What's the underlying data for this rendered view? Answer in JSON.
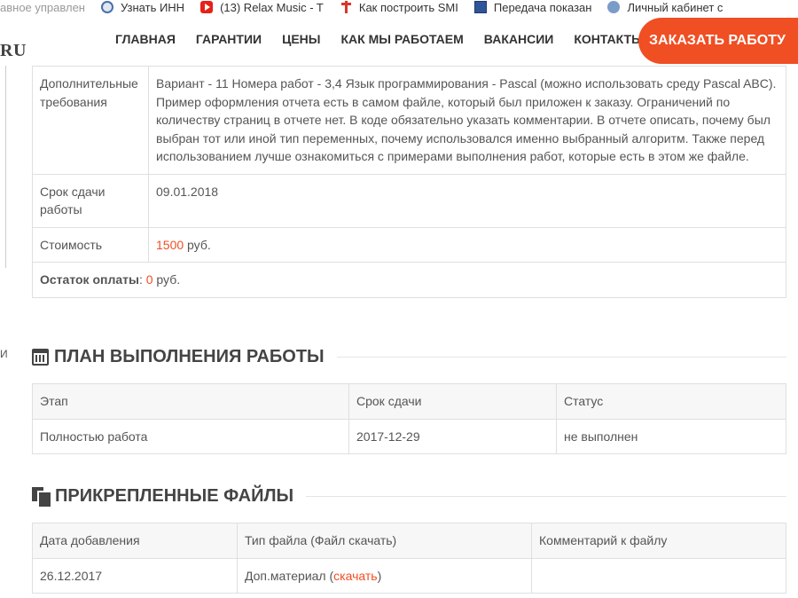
{
  "bookmarks": [
    {
      "label": "авное управлен",
      "icon": "none"
    },
    {
      "label": "Узнать ИНН",
      "icon": "emblem-icon"
    },
    {
      "label": "(13) Relax Music - T",
      "icon": "youtube-icon"
    },
    {
      "label": "Как построить SMI",
      "icon": "pin-icon"
    },
    {
      "label": "Передача показан",
      "icon": "document-icon"
    },
    {
      "label": "Личный кабинет с",
      "icon": "user-icon"
    }
  ],
  "nav": {
    "logo": "RU",
    "menu": [
      "ГЛАВНАЯ",
      "ГАРАНТИИ",
      "ЦЕНЫ",
      "КАК МЫ РАБОТАЕМ",
      "ВАКАНСИИ",
      "КОНТАКТЫ"
    ],
    "order_button": "ЗАКАЗАТЬ РАБОТУ"
  },
  "side": {
    "glyph": "И"
  },
  "details": {
    "extra_label": "Дополнительные требования",
    "extra_value": "Вариант - 11 Номера работ - 3,4 Язык программирования - Pascal (можно использовать среду Pascal ABC). Пример оформления отчета есть в самом файле, который был приложен к заказу. Ограничений по количеству страниц в отчете нет. В коде обязательно указать комментарии. В отчете описать, почему был выбран тот или иной тип переменных, почему использовался именно выбранный алгоритм. Также перед использованием лучше ознакомиться с примерами выполнения работ, которые есть в этом же файле.",
    "deadline_label": "Срок сдачи работы",
    "deadline_value": "09.01.2018",
    "price_label": "Стоимость",
    "price_value": "1500",
    "price_unit": "руб.",
    "balance_label": "Остаток оплаты",
    "balance_colon": ":",
    "balance_value": "0",
    "balance_unit": "руб."
  },
  "plan": {
    "title": "ПЛАН ВЫПОЛНЕНИЯ РАБОТЫ",
    "headers": [
      "Этап",
      "Срок сдачи",
      "Статус"
    ],
    "rows": [
      [
        "Полностью работа",
        "2017-12-29",
        "не выполнен"
      ]
    ]
  },
  "files": {
    "title": "ПРИКРЕПЛЕННЫЕ ФАЙЛЫ",
    "headers": [
      "Дата добавления",
      "Тип файла (Файл скачать)",
      "Комментарий к файлу"
    ],
    "rows": [
      {
        "date": "26.12.2017",
        "type": "Доп.материал",
        "link": "скачать",
        "comment": ""
      }
    ]
  },
  "colors": {
    "accent": "#f04e23",
    "border": "#dfdfdf",
    "header_bg": "#f7f7f7"
  }
}
